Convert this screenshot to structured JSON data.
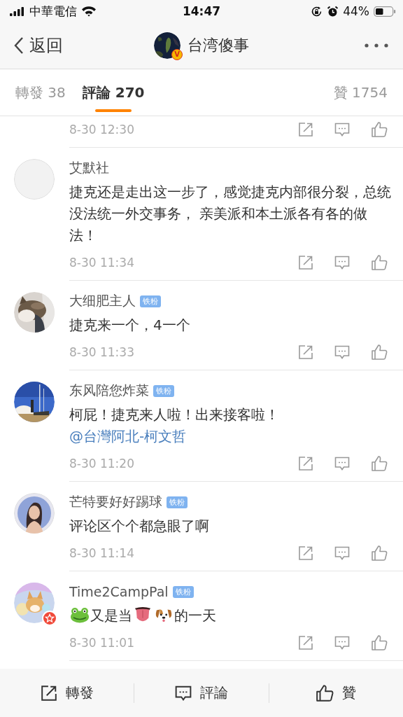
{
  "status_bar": {
    "carrier": "中華電信",
    "time": "14:47",
    "battery": "44%"
  },
  "nav": {
    "back": "返回",
    "title": "台湾傻事",
    "avatar": {
      "kind": "globe",
      "verified_badge": "V"
    }
  },
  "tabs": [
    {
      "label": "轉發 38",
      "selected": false
    },
    {
      "label": "評論 270",
      "selected": true
    },
    {
      "label": "贊 1754",
      "selected": false
    }
  ],
  "comments": [
    {
      "time": "8-30 12:30"
    },
    {
      "name": "艾默社",
      "avatar": {
        "kind": "default"
      },
      "content": [
        {
          "kind": "text",
          "text": "捷克还是走出这一步了，感觉捷克内部很分裂，总统没法统一外交事务， 亲美派和本土派各有各的做法！"
        }
      ],
      "time": "8-30 11:34"
    },
    {
      "name": "大细肥主人",
      "fan_badge": "铁粉",
      "avatar": {
        "kind": "cat"
      },
      "content": [
        {
          "kind": "text",
          "text": "捷克来一个，4一个"
        }
      ],
      "time": "8-30 11:33"
    },
    {
      "name": "东风陪您炸菜",
      "fan_badge": "铁粉",
      "avatar": {
        "kind": "rocket"
      },
      "content": [
        {
          "kind": "text",
          "text": "柯屁！捷克来人啦！出来接客啦！"
        },
        {
          "kind": "mention",
          "text": "@台灣阿北-柯文哲"
        }
      ],
      "time": "8-30 11:20"
    },
    {
      "name": "芒特要好好踢球",
      "fan_badge": "铁粉",
      "avatar": {
        "kind": "figure"
      },
      "content": [
        {
          "kind": "text",
          "text": "评论区个个都急眼了啊"
        }
      ],
      "time": "8-30 11:14"
    },
    {
      "name": "Time2CampPal",
      "fan_badge": "铁粉",
      "avatar": {
        "kind": "cartoon",
        "star_badge": true
      },
      "content": [
        {
          "kind": "frog"
        },
        {
          "kind": "text",
          "text": "又是当"
        },
        {
          "kind": "tongue"
        },
        {
          "kind": "dog"
        },
        {
          "kind": "text",
          "text": "的一天"
        }
      ],
      "time": "8-30 11:01"
    }
  ],
  "bottom_bar": [
    {
      "kind": "share",
      "label": "轉發"
    },
    {
      "kind": "comment",
      "label": "評論"
    },
    {
      "kind": "like",
      "label": "贊"
    }
  ]
}
